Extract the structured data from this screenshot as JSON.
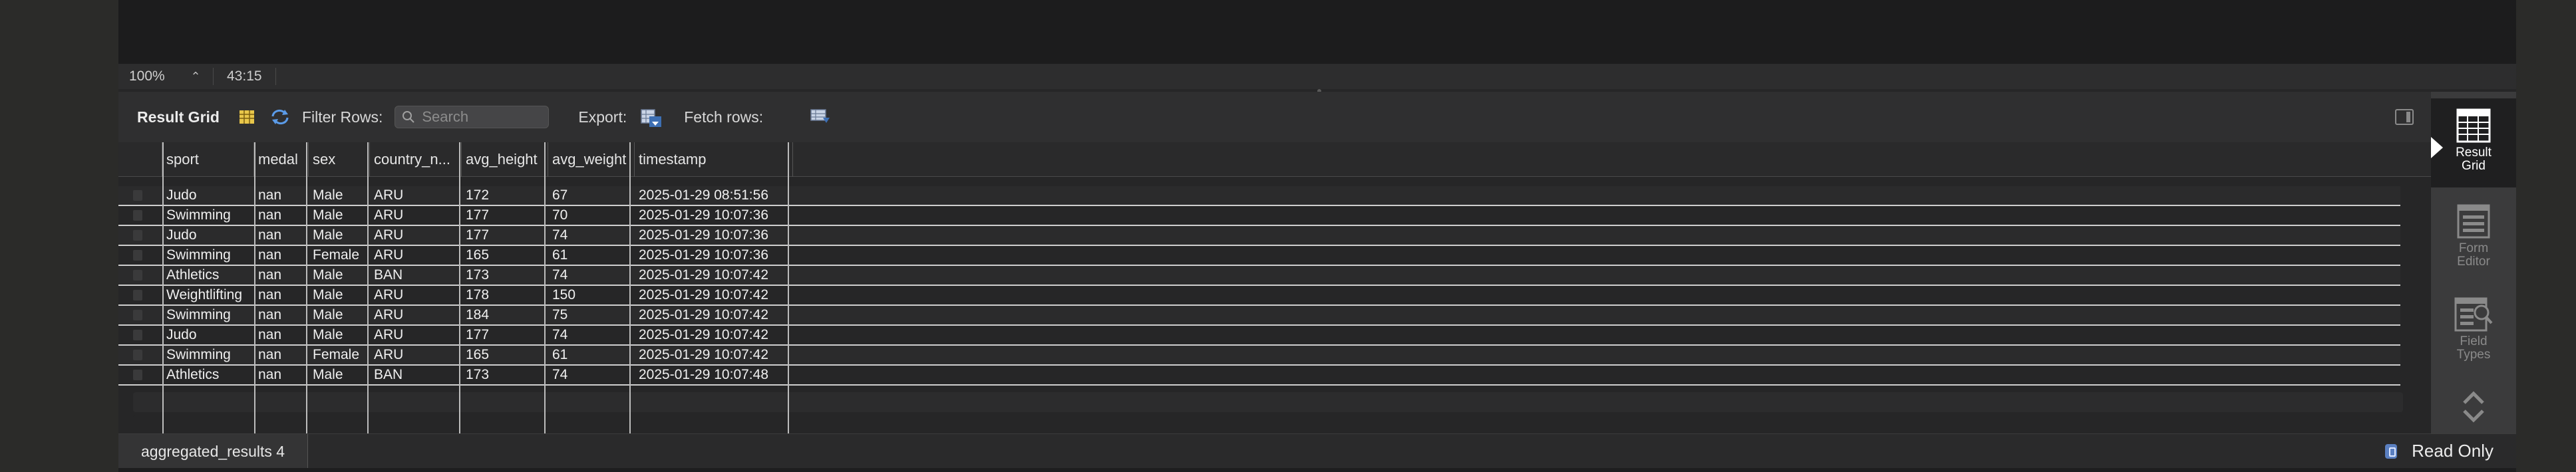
{
  "status": {
    "zoom": "100%",
    "position": "43:15"
  },
  "toolbar": {
    "title": "Result Grid",
    "filter_label": "Filter Rows:",
    "search_placeholder": "Search",
    "export_label": "Export:",
    "fetch_label": "Fetch rows:"
  },
  "grid": {
    "columns": [
      "sport",
      "medal",
      "sex",
      "country_n...",
      "avg_height",
      "avg_weight",
      "timestamp"
    ],
    "rows": [
      [
        "Judo",
        "nan",
        "Male",
        "ARU",
        "172",
        "67",
        "2025-01-29 08:51:56"
      ],
      [
        "Swimming",
        "nan",
        "Male",
        "ARU",
        "177",
        "70",
        "2025-01-29 10:07:36"
      ],
      [
        "Judo",
        "nan",
        "Male",
        "ARU",
        "177",
        "74",
        "2025-01-29 10:07:36"
      ],
      [
        "Swimming",
        "nan",
        "Female",
        "ARU",
        "165",
        "61",
        "2025-01-29 10:07:36"
      ],
      [
        "Athletics",
        "nan",
        "Male",
        "BAN",
        "173",
        "74",
        "2025-01-29 10:07:42"
      ],
      [
        "Weightlifting",
        "nan",
        "Male",
        "ARU",
        "178",
        "150",
        "2025-01-29 10:07:42"
      ],
      [
        "Swimming",
        "nan",
        "Male",
        "ARU",
        "184",
        "75",
        "2025-01-29 10:07:42"
      ],
      [
        "Judo",
        "nan",
        "Male",
        "ARU",
        "177",
        "74",
        "2025-01-29 10:07:42"
      ],
      [
        "Swimming",
        "nan",
        "Female",
        "ARU",
        "165",
        "61",
        "2025-01-29 10:07:42"
      ],
      [
        "Athletics",
        "nan",
        "Male",
        "BAN",
        "173",
        "74",
        "2025-01-29 10:07:48"
      ]
    ]
  },
  "side_panel": {
    "result_grid": "Result\nGrid",
    "form_editor": "Form\nEditor",
    "field_types": "Field\nTypes"
  },
  "bottom": {
    "tab_label": "aggregated_results 4",
    "readonly_label": "Read Only"
  },
  "colors": {
    "background": "#2a2a28",
    "panel": "#2f2f30",
    "row_line": "#cfcfcf",
    "active_side": "#1f1f20"
  }
}
